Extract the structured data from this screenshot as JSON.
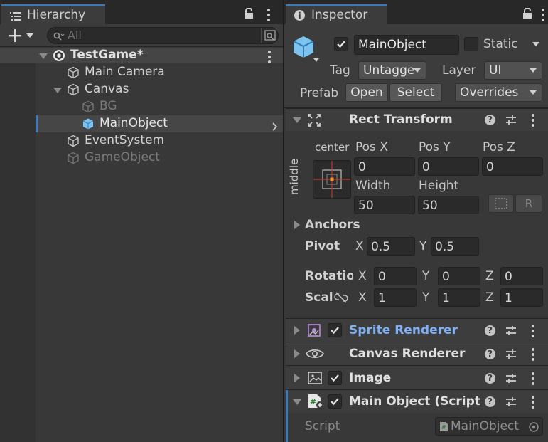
{
  "hierarchy": {
    "tab_label": "Hierarchy",
    "search_placeholder": "All",
    "scene_name": "TestGame*",
    "items": [
      {
        "label": "Main Camera",
        "depth": 1,
        "dim": false
      },
      {
        "label": "Canvas",
        "depth": 1,
        "dim": false
      },
      {
        "label": "BG",
        "depth": 2,
        "dim": true
      },
      {
        "label": "MainObject",
        "depth": 2,
        "dim": false,
        "selected": true
      },
      {
        "label": "EventSystem",
        "depth": 1,
        "dim": false
      },
      {
        "label": "GameObject",
        "depth": 1,
        "dim": true
      }
    ]
  },
  "inspector": {
    "tab_label": "Inspector",
    "object_name": "MainObject",
    "static_label": "Static",
    "tag_label": "Tag",
    "tag_value": "Untagge",
    "layer_label": "Layer",
    "layer_value": "UI",
    "prefab_label": "Prefab",
    "prefab_open": "Open",
    "prefab_select": "Select",
    "prefab_overrides": "Overrides",
    "rect_transform": {
      "title": "Rect Transform",
      "anchor_h": "center",
      "anchor_v": "middle",
      "pos_x_label": "Pos X",
      "pos_y_label": "Pos Y",
      "pos_z_label": "Pos Z",
      "pos_x": "0",
      "pos_y": "0",
      "pos_z": "0",
      "width_label": "Width",
      "height_label": "Height",
      "width": "50",
      "height": "50",
      "r_label": "R",
      "anchors_label": "Anchors",
      "pivot_label": "Pivot",
      "pivot_x_label": "X",
      "pivot_y_label": "Y",
      "pivot_x": "0.5",
      "pivot_y": "0.5",
      "rotation_label": "Rotatioı",
      "rot_x": "0",
      "rot_y": "0",
      "rot_z": "0",
      "scale_label": "Scal",
      "scale_x": "1",
      "scale_y": "1",
      "scale_z": "1",
      "x_label": "X",
      "y_label": "Y",
      "z_label": "Z"
    },
    "components": [
      {
        "title": "Sprite Renderer",
        "highlight": true
      },
      {
        "title": "Canvas Renderer",
        "highlight": false
      },
      {
        "title": "Image",
        "highlight": false
      },
      {
        "title": "Main Object (Script",
        "highlight": false
      }
    ],
    "script_label": "Script",
    "script_value": "MainObject",
    "help_glyph": "?"
  },
  "colors": {
    "accent": "#3a79bb",
    "selection": "#2c5d87",
    "link_blue": "#7fb0f5"
  }
}
